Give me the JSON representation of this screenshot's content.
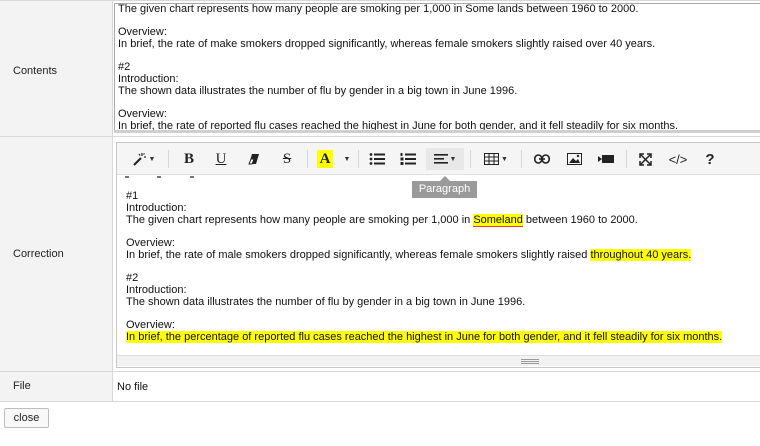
{
  "labels": {
    "contents": "Contents",
    "correction": "Correction",
    "file": "File"
  },
  "contents": {
    "lines": [
      "The given chart represents how many people are smoking per 1,000 in Some lands between 1960 to 2000.",
      "",
      "Overview:",
      "In brief, the rate of make smokers dropped significantly, whereas female smokers slightly raised over 40 years.",
      "",
      "#2",
      "Introduction:",
      "The shown data illustrates the number of flu by gender in a big town in June 1996.",
      "",
      "Overview:",
      "In brief, the rate of reported flu cases reached the highest in June for both gender, and it fell steadily for six months."
    ]
  },
  "toolbar": {
    "buttons": [
      {
        "name": "magic-style-button",
        "icon": "magic-wand-icon"
      },
      {
        "name": "bold-button",
        "icon": "bold-icon",
        "text": "B"
      },
      {
        "name": "underline-button",
        "icon": "underline-icon",
        "text": "U"
      },
      {
        "name": "eraser-button",
        "icon": "eraser-icon"
      },
      {
        "name": "strikethrough-button",
        "icon": "strikethrough-icon",
        "text": "S"
      },
      {
        "name": "font-color-button",
        "icon": "font-color-icon",
        "text": "A"
      },
      {
        "name": "font-color-dropdown",
        "icon": "caret-down-icon"
      },
      {
        "name": "unordered-list-button",
        "icon": "unordered-list-icon"
      },
      {
        "name": "ordered-list-button",
        "icon": "ordered-list-icon"
      },
      {
        "name": "paragraph-button",
        "icon": "align-left-icon"
      },
      {
        "name": "table-button",
        "icon": "table-icon"
      },
      {
        "name": "link-button",
        "icon": "link-icon"
      },
      {
        "name": "picture-button",
        "icon": "picture-icon"
      },
      {
        "name": "video-button",
        "icon": "video-icon"
      },
      {
        "name": "fullscreen-button",
        "icon": "fullscreen-icon"
      },
      {
        "name": "code-view-button",
        "icon": "code-icon",
        "text": "</>"
      },
      {
        "name": "help-button",
        "icon": "help-icon",
        "text": "?"
      }
    ],
    "tooltip": "Paragraph"
  },
  "correction": {
    "intro_heading": "#1",
    "intro_label": "Introduction:",
    "intro_before": "The given chart represents how many people are smoking per 1,000 in ",
    "intro_highlight": "Someland",
    "intro_after": " between 1960 to 2000.",
    "overview_label": "Overview:",
    "overview_before": "In brief, the rate of male smokers dropped significantly, whereas female smokers slightly raised ",
    "overview_highlight": "throughout 40 years.",
    "second_heading": "#2",
    "second_intro_label": "Introduction:",
    "second_intro_text": "The shown data illustrates the number of flu by gender in a big town in June 1996.",
    "second_overview_label": "Overview:",
    "second_overview_highlight": "In brief,  the percentage of reported flu cases reached the highest in June for both gender, and it fell steadily for six months."
  },
  "file": {
    "value": "No file"
  },
  "actions": {
    "close_label": "close"
  },
  "colors": {
    "highlight": "#ffff00",
    "spellcheck": "#e03b3b",
    "label_bg": "#f3f3f3",
    "tooltip_bg": "#9a9a9a"
  }
}
